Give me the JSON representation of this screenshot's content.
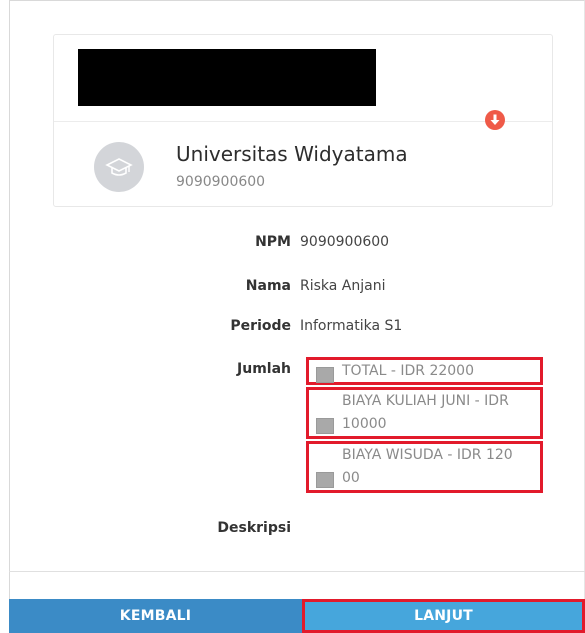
{
  "institution": {
    "name": "Universitas Widyatama",
    "code": "9090900600"
  },
  "details": {
    "npm_label": "NPM",
    "npm_value": "9090900600",
    "nama_label": "Nama",
    "nama_value": "Riska Anjani",
    "periode_label": "Periode",
    "periode_value": "Informatika S1",
    "jumlah_label": "Jumlah",
    "deskripsi_label": "Deskripsi"
  },
  "payment_options": [
    {
      "line1": "TOTAL - IDR 22000",
      "line2": ""
    },
    {
      "line1": "BIAYA KULIAH JUNI - IDR",
      "line2": "10000"
    },
    {
      "line1": "BIAYA WISUDA - IDR 120",
      "line2": "00"
    }
  ],
  "buttons": {
    "back": "KEMBALI",
    "next": "LANJUT"
  },
  "icons": {
    "avatar": "graduation-cap-icon",
    "download": "download-icon"
  },
  "colors": {
    "primary_button": "#3b8bc6",
    "next_button": "#46a6dc",
    "highlight_border": "#e21a2b",
    "badge": "#ef5a48"
  }
}
